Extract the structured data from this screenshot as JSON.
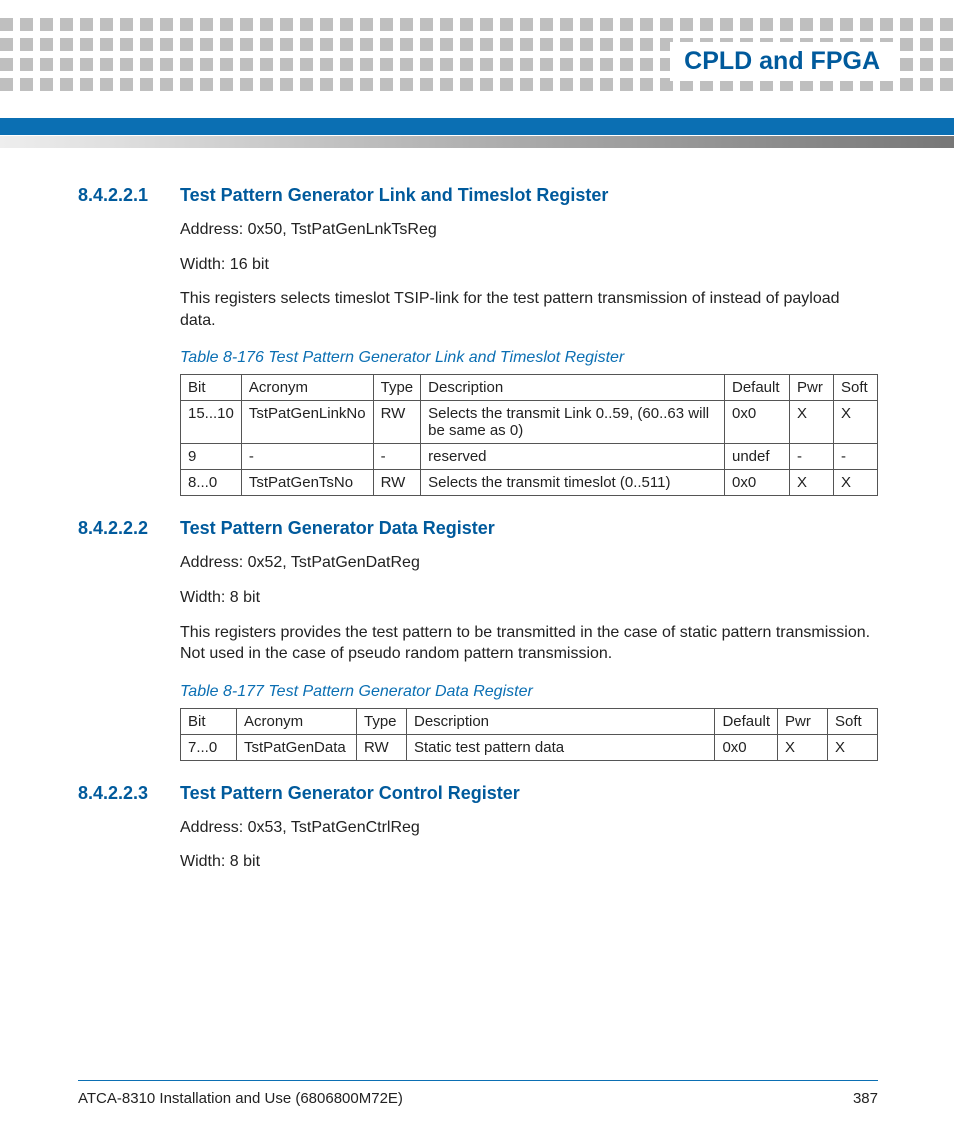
{
  "chapter_title": "CPLD and FPGA",
  "sections": [
    {
      "num": "8.4.2.2.1",
      "title": "Test Pattern Generator Link and Timeslot Register",
      "body": [
        "Address: 0x50, TstPatGenLnkTsReg",
        "Width: 16 bit",
        "This registers selects timeslot TSIP-link for the test pattern transmission of instead of payload data."
      ],
      "table": {
        "caption": "Table 8-176 Test Pattern Generator Link and Timeslot Register",
        "header": [
          "Bit",
          "Acronym",
          "Type",
          "Description",
          "Default",
          "Pwr",
          "Soft"
        ],
        "rows": [
          [
            "15...10",
            "TstPatGenLinkNo",
            "RW",
            "Selects the transmit Link 0..59, (60..63 will be same as 0)",
            "0x0",
            "X",
            "X"
          ],
          [
            "9",
            "-",
            "-",
            "reserved",
            "undef",
            "-",
            "-"
          ],
          [
            "8...0",
            "TstPatGenTsNo",
            "RW",
            "Selects the transmit timeslot (0..511)",
            "0x0",
            "X",
            "X"
          ]
        ]
      }
    },
    {
      "num": "8.4.2.2.2",
      "title": "Test Pattern Generator Data Register",
      "body": [
        "Address: 0x52, TstPatGenDatReg",
        "Width: 8 bit",
        "This registers provides the test pattern to be transmitted in the case of static pattern transmission. Not used in the case of pseudo random pattern transmission."
      ],
      "table": {
        "caption": "Table 8-177 Test Pattern Generator Data Register",
        "header": [
          "Bit",
          "Acronym",
          "Type",
          "Description",
          "Default",
          "Pwr",
          "Soft"
        ],
        "rows": [
          [
            "7...0",
            "TstPatGenData",
            "RW",
            "Static test pattern data",
            "0x0",
            "X",
            "X"
          ]
        ]
      }
    },
    {
      "num": "8.4.2.2.3",
      "title": "Test Pattern Generator Control Register",
      "body": [
        "Address: 0x53, TstPatGenCtrlReg",
        "Width: 8 bit"
      ],
      "table": null
    }
  ],
  "footer": {
    "doc": "ATCA-8310 Installation and Use (6806800M72E)",
    "page": "387"
  },
  "col_widths": [
    [
      "60",
      "130",
      "44",
      "",
      "65",
      "44",
      "44"
    ],
    [
      "56",
      "120",
      "50",
      "",
      "62",
      "50",
      "50"
    ]
  ]
}
